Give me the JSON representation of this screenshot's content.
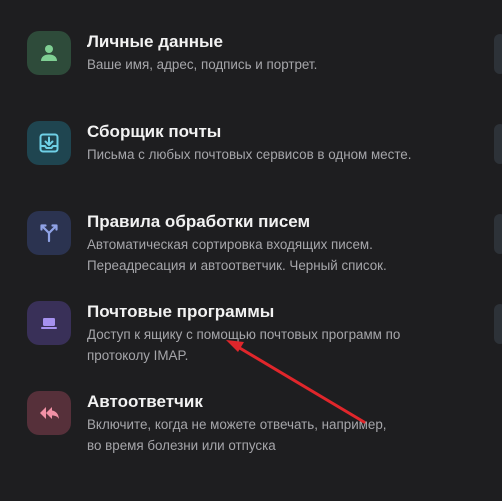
{
  "items": [
    {
      "title": "Личные данные",
      "description": [
        "Ваше имя, адрес, подпись и портрет."
      ],
      "icon": "person-icon",
      "tile_color": "#2e4b3a",
      "icon_color": "#7fcf93"
    },
    {
      "title": "Сборщик почты",
      "description": [
        "Письма с любых почтовых сервисов в одном месте."
      ],
      "icon": "inbox-download-icon",
      "tile_color": "#1f4550",
      "icon_color": "#6fd0e6"
    },
    {
      "title": "Правила обработки писем",
      "description": [
        "Автоматическая сортировка входящих писем.",
        "Переадресация и автоответчик. Черный список."
      ],
      "icon": "branching-arrows-icon",
      "tile_color": "#2b3350",
      "icon_color": "#8fa2e6"
    },
    {
      "title": "Почтовые программы",
      "description": [
        "Доступ к ящику с помощью почтовых программ по",
        "протоколу IMAP."
      ],
      "icon": "laptop-icon",
      "tile_color": "#393058",
      "icon_color": "#a691f0"
    },
    {
      "title": "Автоответчик",
      "description": [
        "Включите, когда не можете отвечать, например,",
        "во время болезни или отпуска"
      ],
      "icon": "double-reply-icon",
      "tile_color": "#56303a",
      "icon_color": "#f291a6"
    }
  ],
  "annotation_color": "#e0262b"
}
